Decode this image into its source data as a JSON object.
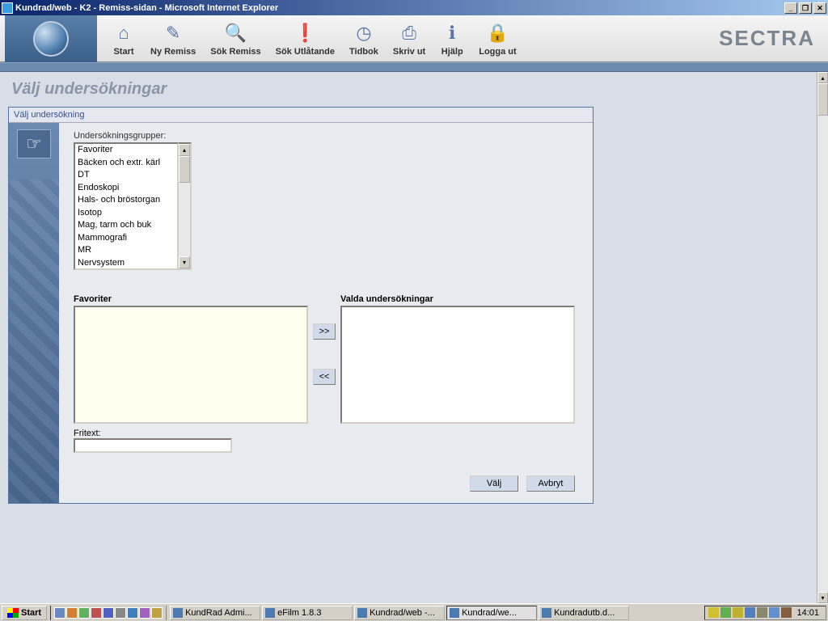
{
  "window": {
    "title": "Kundrad/web - K2 - Remiss-sidan - Microsoft Internet Explorer"
  },
  "toolbar": {
    "brand": "SECTRA",
    "items": [
      {
        "label": "Start",
        "glyph": "⌂"
      },
      {
        "label": "Ny Remiss",
        "glyph": "✎"
      },
      {
        "label": "Sök Remiss",
        "glyph": "🔍"
      },
      {
        "label": "Sök Utlåtande",
        "glyph": "❗"
      },
      {
        "label": "Tidbok",
        "glyph": "◷"
      },
      {
        "label": "Skriv ut",
        "glyph": "⎙"
      },
      {
        "label": "Hjälp",
        "glyph": "ℹ"
      },
      {
        "label": "Logga ut",
        "glyph": "🔒"
      }
    ]
  },
  "page": {
    "heading": "Välj undersökningar",
    "panel_title": "Välj undersökning"
  },
  "groups": {
    "label": "Undersökningsgrupper:",
    "options": [
      "Favoriter",
      "Bäcken och extr. kärl",
      "DT",
      "Endoskopi",
      "Hals- och bröstorgan",
      "Isotop",
      "Mag, tarm och buk",
      "Mammografi",
      "MR",
      "Nervsystem"
    ]
  },
  "transfer": {
    "left_label": "Favoriter",
    "right_label": "Valda undersökningar",
    "add": ">>",
    "remove": "<<"
  },
  "freetext": {
    "label": "Fritext:",
    "value": ""
  },
  "buttons": {
    "ok": "Välj",
    "cancel": "Avbryt"
  },
  "taskbar": {
    "start": "Start",
    "tasks": [
      {
        "label": "KundRad Admi...",
        "active": false
      },
      {
        "label": "eFilm 1.8.3",
        "active": false
      },
      {
        "label": "Kundrad/web -...",
        "active": false
      },
      {
        "label": "Kundrad/we...",
        "active": true
      },
      {
        "label": "Kundradutb.d...",
        "active": false
      }
    ],
    "clock": "14:01"
  }
}
